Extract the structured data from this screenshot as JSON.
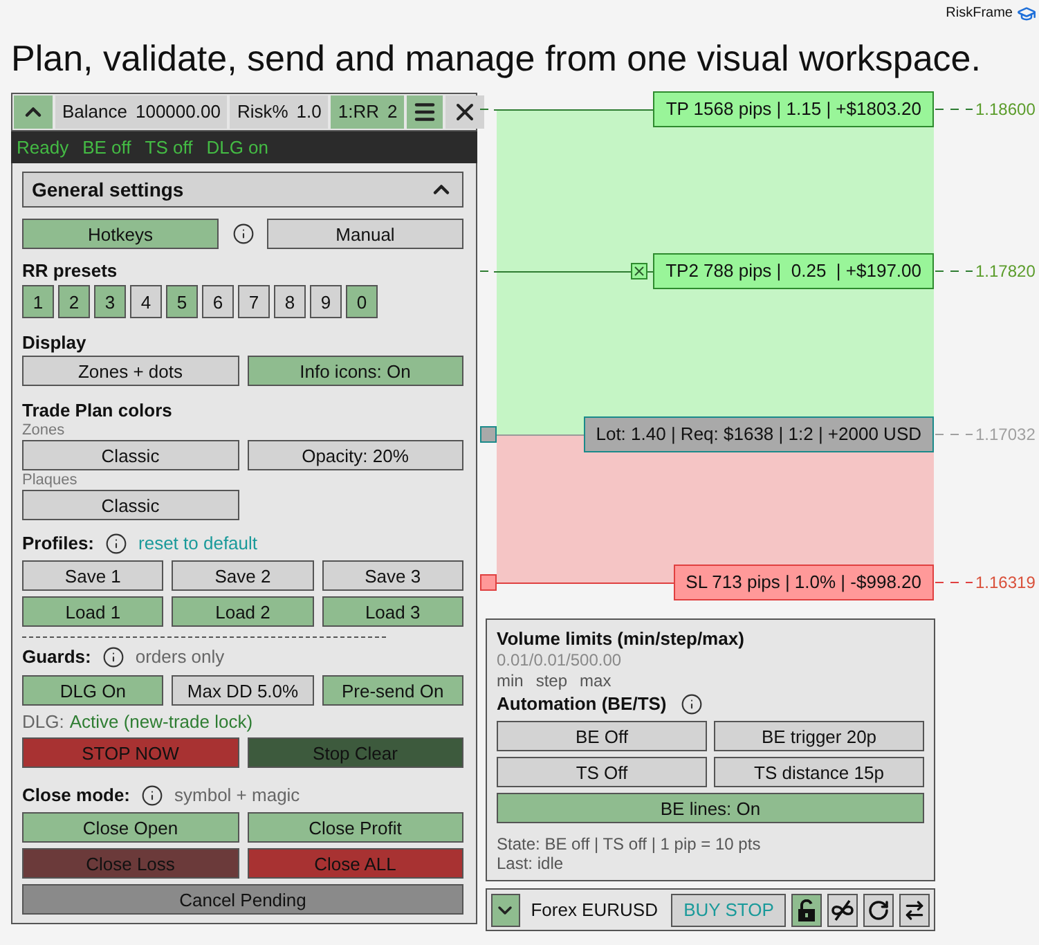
{
  "brand": {
    "name": "RiskFrame"
  },
  "headline": "Plan, validate, send and manage from one visual workspace.",
  "toolbar": [
    {
      "kind": "collapse",
      "active": true
    },
    {
      "kind": "field",
      "label": "Balance",
      "value": "100000.00",
      "active": false
    },
    {
      "kind": "field",
      "label": "Risk%",
      "value": "1.0",
      "active": false
    },
    {
      "kind": "field",
      "label": "1:RR",
      "value": "2",
      "active": true
    },
    {
      "kind": "menu",
      "active": true
    },
    {
      "kind": "close",
      "active": false
    }
  ],
  "status": [
    "Ready",
    "BE off",
    "TS off",
    "DLG on"
  ],
  "general": {
    "title": "General settings",
    "expanded": true,
    "mode_buttons": [
      {
        "label": "Hotkeys",
        "active": true
      },
      {
        "label": "Manual",
        "active": false
      }
    ]
  },
  "rr_presets": {
    "title": "RR presets",
    "items": [
      {
        "label": "1",
        "active": true
      },
      {
        "label": "2",
        "active": true
      },
      {
        "label": "3",
        "active": true
      },
      {
        "label": "4",
        "active": false
      },
      {
        "label": "5",
        "active": true
      },
      {
        "label": "6",
        "active": false
      },
      {
        "label": "7",
        "active": false
      },
      {
        "label": "8",
        "active": false
      },
      {
        "label": "9",
        "active": false
      },
      {
        "label": "0",
        "active": true
      }
    ]
  },
  "display": {
    "title": "Display",
    "buttons": [
      {
        "label": "Zones + dots",
        "active": false
      },
      {
        "label": "Info icons: On",
        "active": true
      }
    ]
  },
  "trade_plan_colors": {
    "title": "Trade Plan colors",
    "groups": [
      {
        "label": "Zones",
        "buttons": [
          {
            "label": "Classic",
            "active": false
          },
          {
            "label": "Opacity: 20%",
            "active": false
          }
        ]
      },
      {
        "label": "Plaques",
        "buttons": [
          {
            "label": "Classic",
            "active": false
          }
        ]
      }
    ]
  },
  "profiles": {
    "title": "Profiles:",
    "link": "reset to default",
    "rows": [
      [
        {
          "label": "Save 1",
          "color": "#d3d3d3"
        },
        {
          "label": "Save 2",
          "color": "#d3d3d3"
        },
        {
          "label": "Save 3",
          "color": "#d3d3d3"
        }
      ],
      [
        {
          "label": "Load 1",
          "color": "#8fbc8f"
        },
        {
          "label": "Load 2",
          "color": "#8fbc8f"
        },
        {
          "label": "Load 3",
          "color": "#8fbc8f"
        }
      ]
    ]
  },
  "guards": {
    "title": "Guards:",
    "note": "orders only",
    "buttons": [
      {
        "label": "DLG On",
        "active": true
      },
      {
        "label": "Max DD 5.0%",
        "active": false
      },
      {
        "label": "Pre-send On",
        "active": true
      }
    ],
    "dlg_label": "DLG:",
    "dlg_value": "Active (new-trade lock)",
    "actions": [
      {
        "label": "STOP NOW",
        "color": "#a83232"
      },
      {
        "label": "Stop Clear",
        "color": "#3d5a3d"
      }
    ]
  },
  "close_mode": {
    "title": "Close mode:",
    "note": "symbol + magic",
    "rows": [
      [
        {
          "label": "Close Open",
          "color": "#8fbc8f"
        },
        {
          "label": "Close Profit",
          "color": "#8fbc8f"
        }
      ],
      [
        {
          "label": "Close Loss",
          "color": "#6b3a3a"
        },
        {
          "label": "Close ALL",
          "color": "#a83232"
        }
      ],
      [
        {
          "label": "Cancel Pending",
          "color": "#8a8a8a"
        }
      ]
    ]
  },
  "levels": [
    {
      "kind": "tp",
      "label": "TP 1568 pips | 1.15 | +$1803.20",
      "price": "1.18600"
    },
    {
      "kind": "tp2",
      "label": "TP2 788 pips |  0.25  | +$197.00",
      "price": "1.17820"
    },
    {
      "kind": "entry",
      "label": "Lot: 1.40 | Req: $1638 | 1:2 | +2000 USD",
      "price": "1.17032"
    },
    {
      "kind": "sl",
      "label": "SL 713 pips | 1.0% | -$998.20",
      "price": "1.16319"
    }
  ],
  "volume": {
    "title": "Volume limits (min/step/max)",
    "values": "0.01/0.01/500.00",
    "legend": [
      "min",
      "step",
      "max"
    ]
  },
  "automation": {
    "title": "Automation (BE/TS)",
    "rows": [
      [
        {
          "label": "BE Off",
          "active": false
        },
        {
          "label": "BE trigger 20p",
          "active": false
        }
      ],
      [
        {
          "label": "TS Off",
          "active": false
        },
        {
          "label": "TS distance 15p",
          "active": false
        }
      ],
      [
        {
          "label": "BE lines: On",
          "active": true
        }
      ]
    ],
    "state": "State: BE off | TS off | 1 pip = 10 pts",
    "last": "Last: idle"
  },
  "order_bar": {
    "expand": {
      "active": true
    },
    "symbol": "Forex EURUSD",
    "order_type": "BUY STOP",
    "tools": [
      {
        "kind": "lock",
        "active": true
      },
      {
        "kind": "hide",
        "active": false
      },
      {
        "kind": "refresh",
        "active": false
      },
      {
        "kind": "swap",
        "active": false
      }
    ]
  }
}
